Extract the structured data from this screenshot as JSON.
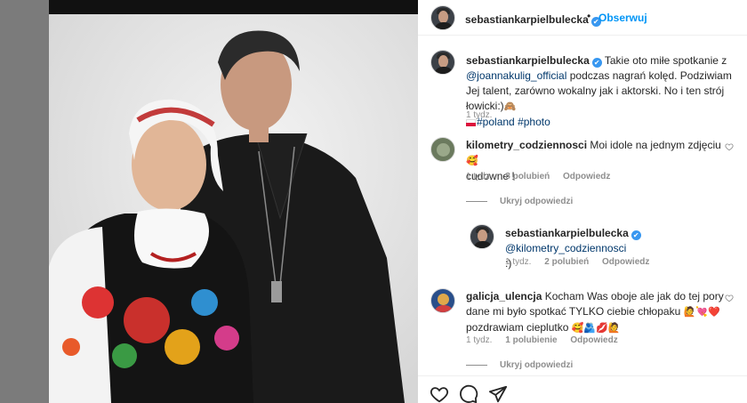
{
  "post": {
    "username": "sebastiankarpielbulecka",
    "verified_mark": "✔",
    "separator": "•",
    "follow_label": "Obserwuj"
  },
  "caption": {
    "username": "sebastiankarpielbulecka",
    "text_before_mention": "Takie oto miłe spotkanie z",
    "mention": "@joannakulig_official",
    "text_after_mention": "podczas nagrań kolęd. Podziwiam Jej talent, zarówno wokalny jak i aktorski. No i ten strój łowicki:)",
    "emoji_end": "🙈",
    "hashtag_1": "#poland",
    "hashtag_2": "#photo",
    "time": "1 tydz."
  },
  "comments": [
    {
      "username": "kilometry_codziennosci",
      "text": "Moi idole na jednym zdjęciu",
      "emoji": "🥰",
      "text_line2": "cudowne !",
      "time": "1 tydz.",
      "likes": "8 polubień",
      "reply_label": "Odpowiedz",
      "toggle_label": "Ukryj odpowiedzi",
      "reply": {
        "username": "sebastiankarpielbulecka",
        "mention": "@kilometry_codziennosci",
        "text": ":)",
        "time": "1 tydz.",
        "likes": "2 polubień",
        "reply_label": "Odpowiedz"
      }
    },
    {
      "username": "galicja_ulencja",
      "text": "Kocham Was oboje ale jak do tej pory dane mi było spotkać TYLKO ciebie chłopaku",
      "emoji_mid": "🙋💘❤️",
      "text_after": "pozdrawiam cieplutko",
      "emoji_end": "🥰🫂💋🙋",
      "time": "1 tydz.",
      "likes": "1 polubienie",
      "reply_label": "Odpowiedz",
      "toggle_label": "Ukryj odpowiedzi"
    }
  ],
  "icons": {
    "like": "heart-icon",
    "comment": "comment-icon",
    "share": "paper-plane-icon"
  },
  "colors": {
    "link": "#00376b",
    "follow": "#0095f6",
    "verified": "#3897f0",
    "meta": "#8e8e8e"
  }
}
